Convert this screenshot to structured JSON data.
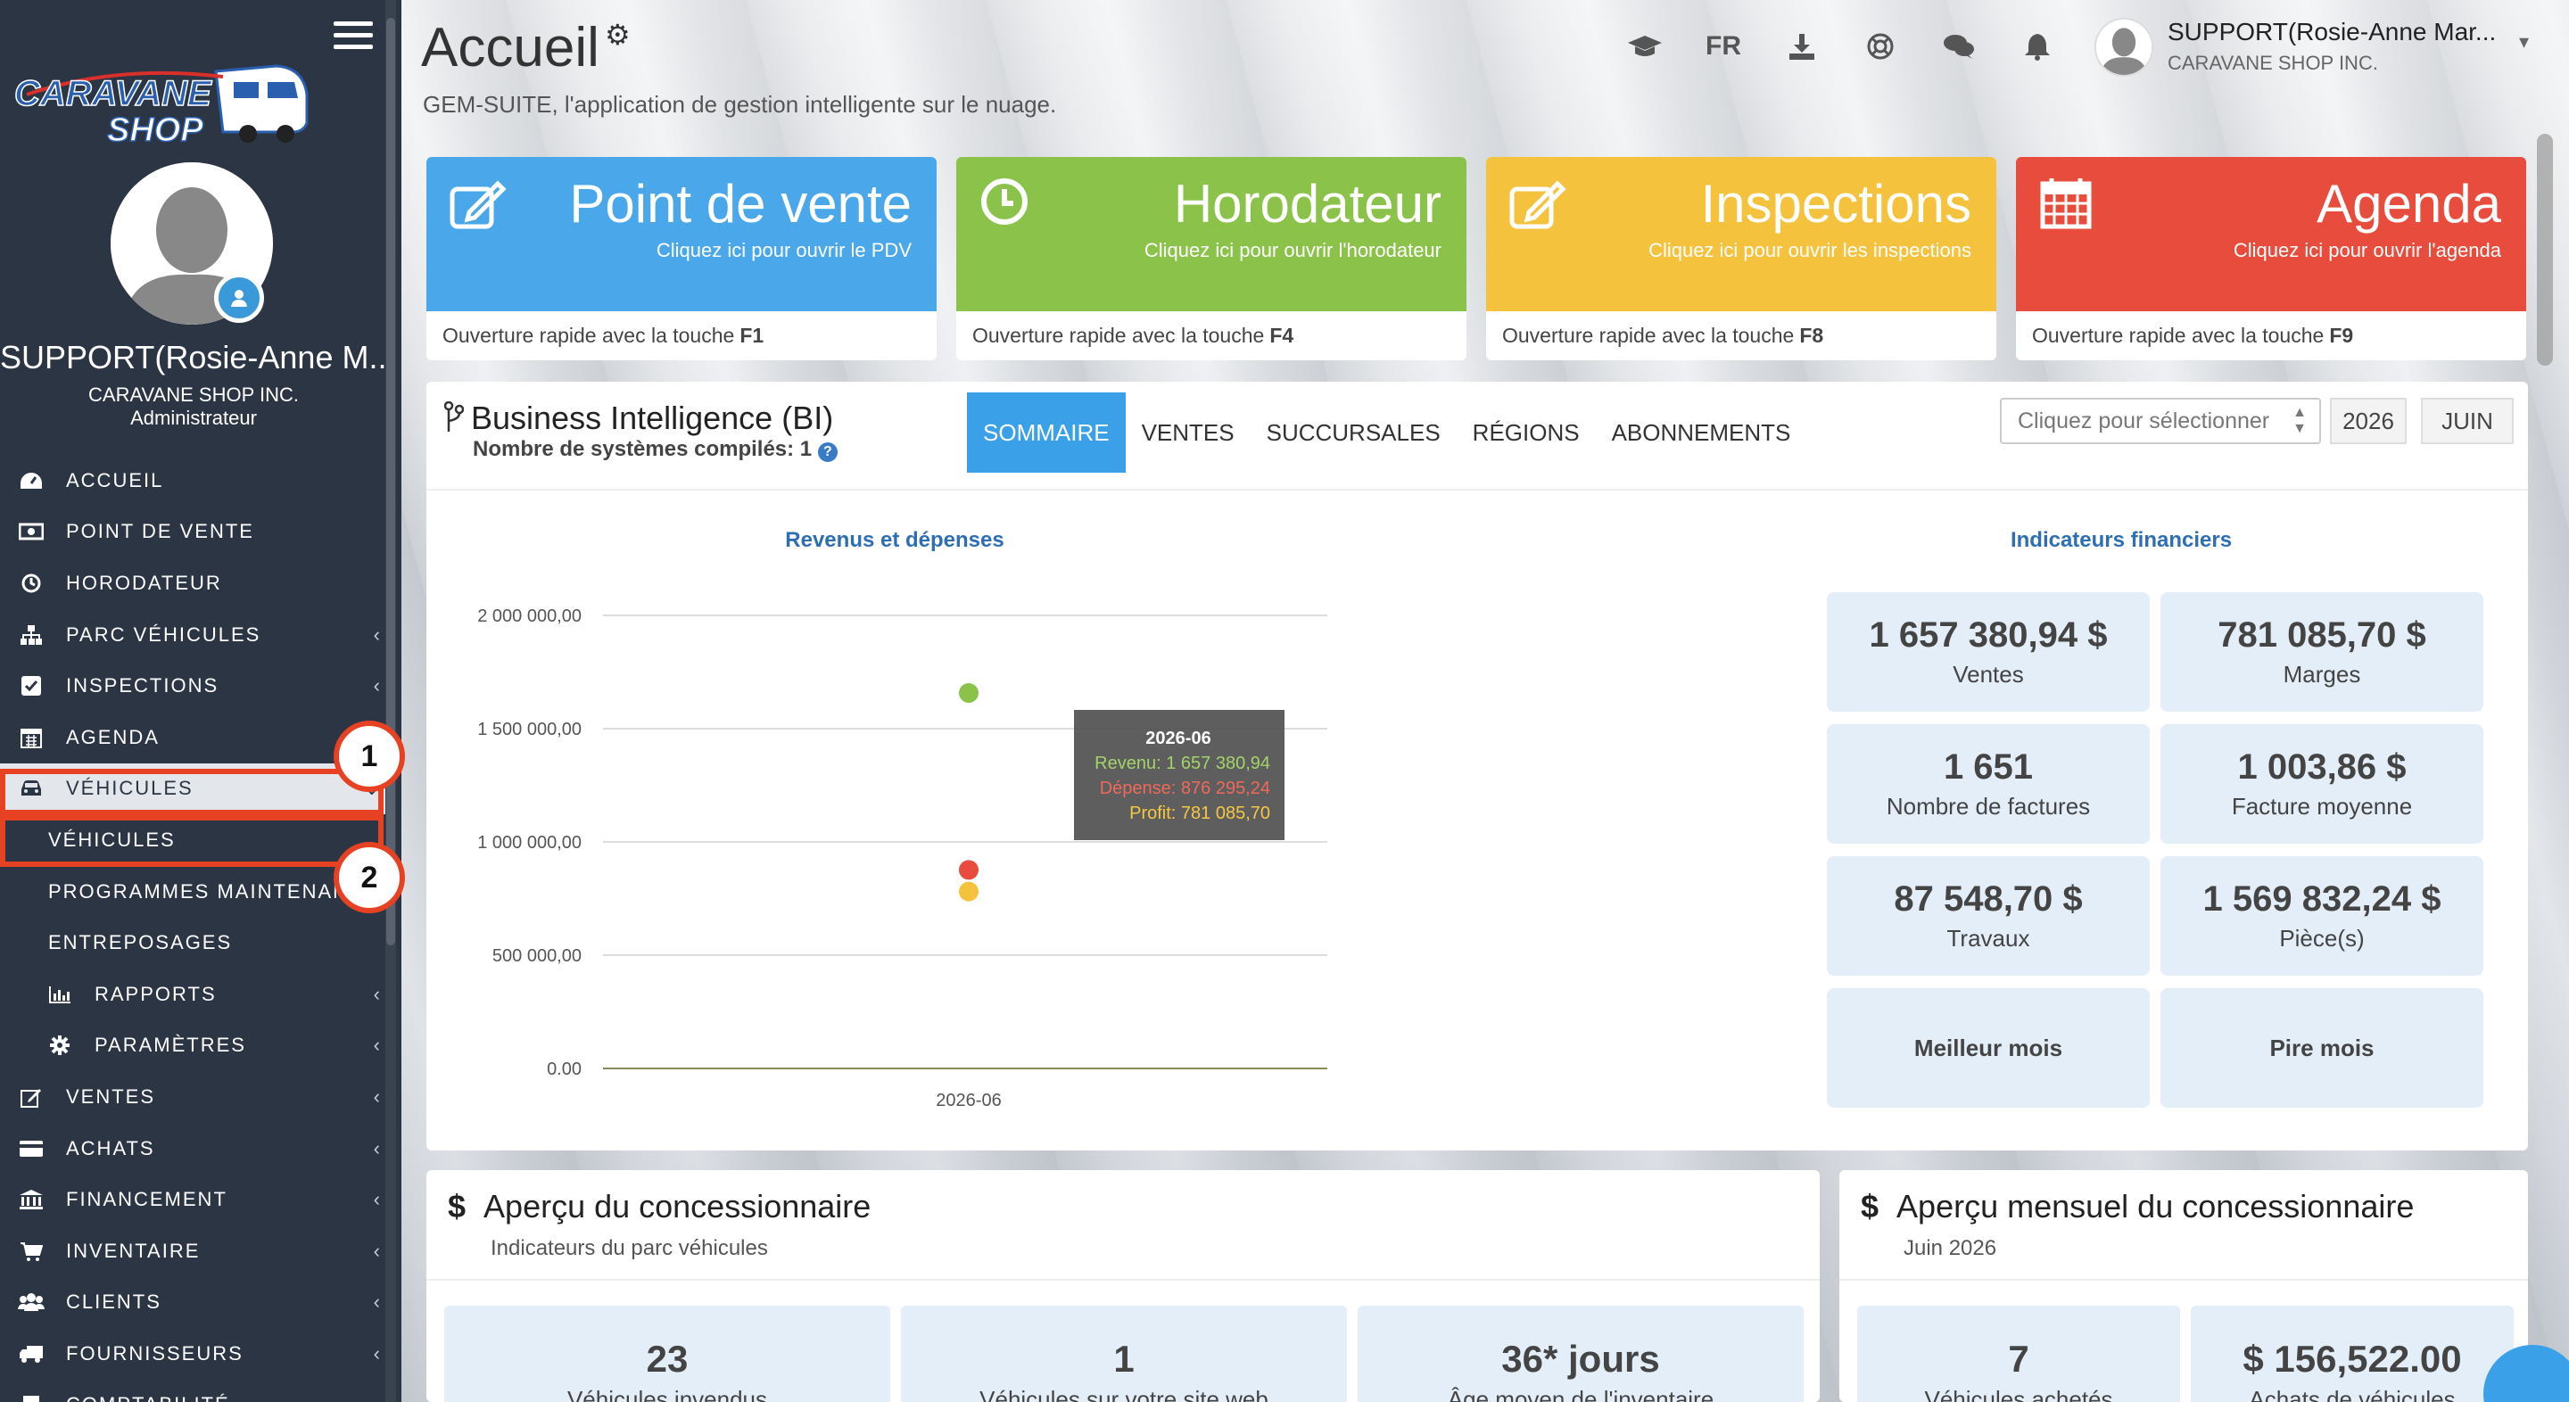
{
  "sidebar": {
    "logo_text_1": "CARAVANE",
    "logo_text_2": "SHOP",
    "user_name": "SUPPORT(Rosie-Anne M...",
    "company": "CARAVANE SHOP INC.",
    "role": "Administrateur",
    "items": [
      {
        "label": "ACCUEIL",
        "icon": "dashboard-icon",
        "chev": ""
      },
      {
        "label": "POINT DE VENTE",
        "icon": "cash-icon",
        "chev": ""
      },
      {
        "label": "HORODATEUR",
        "icon": "clock-icon",
        "chev": ""
      },
      {
        "label": "PARC VÉHICULES",
        "icon": "sitemap-icon",
        "chev": "‹"
      },
      {
        "label": "INSPECTIONS",
        "icon": "checkbox-icon",
        "chev": "‹"
      },
      {
        "label": "AGENDA",
        "icon": "calendar-icon",
        "chev": ""
      },
      {
        "label": "VÉHICULES",
        "icon": "car-icon",
        "chev": "⌄"
      },
      {
        "label": "VÉHICULES",
        "icon": "",
        "chev": ""
      },
      {
        "label": "PROGRAMMES MAINTENANC",
        "icon": "",
        "chev": ""
      },
      {
        "label": "ENTREPOSAGES",
        "icon": "",
        "chev": ""
      },
      {
        "label": "RAPPORTS",
        "icon": "bar-chart-icon",
        "chev": "‹"
      },
      {
        "label": "PARAMÈTRES",
        "icon": "gear-icon",
        "chev": "‹"
      },
      {
        "label": "VENTES",
        "icon": "edit-icon",
        "chev": "‹"
      },
      {
        "label": "ACHATS",
        "icon": "credit-card-icon",
        "chev": "‹"
      },
      {
        "label": "FINANCEMENT",
        "icon": "bank-icon",
        "chev": "‹"
      },
      {
        "label": "INVENTAIRE",
        "icon": "cart-icon",
        "chev": "‹"
      },
      {
        "label": "CLIENTS",
        "icon": "users-icon",
        "chev": "‹"
      },
      {
        "label": "FOURNISSEURS",
        "icon": "truck-icon",
        "chev": "‹"
      },
      {
        "label": "COMPTABILITÉ",
        "icon": "book-icon",
        "chev": ""
      }
    ],
    "callouts": [
      "1",
      "2"
    ]
  },
  "header": {
    "title": "Accueil",
    "subtitle": "GEM-SUITE, l'application de gestion intelligente sur le nuage.",
    "lang": "FR",
    "user_name": "SUPPORT(Rosie-Anne Mar...",
    "user_company": "CARAVANE SHOP INC."
  },
  "tiles": [
    {
      "title": "Point de vente",
      "sub": "Cliquez ici pour ouvrir le PDV",
      "foot": "Ouverture rapide avec la touche",
      "key": "F1",
      "color": "#4aa8ea",
      "icon": "edit-icon"
    },
    {
      "title": "Horodateur",
      "sub": "Cliquez ici pour ouvrir l'horodateur",
      "foot": "Ouverture rapide avec la touche",
      "key": "F4",
      "color": "#8bc34a",
      "icon": "clock-icon"
    },
    {
      "title": "Inspections",
      "sub": "Cliquez ici pour ouvrir les inspections",
      "foot": "Ouverture rapide avec la touche",
      "key": "F8",
      "color": "#f5c23e",
      "icon": "edit-icon"
    },
    {
      "title": "Agenda",
      "sub": "Cliquez ici pour ouvrir l'agenda",
      "foot": "Ouverture rapide avec la touche",
      "key": "F9",
      "color": "#e74c3c",
      "icon": "calendar-icon"
    }
  ],
  "bi": {
    "title": "Business Intelligence (BI)",
    "subtitle": "Nombre de systèmes compilés: 1",
    "tabs": [
      "SOMMAIRE",
      "VENTES",
      "SUCCURSALES",
      "RÉGIONS",
      "ABONNEMENTS"
    ],
    "select_placeholder": "Cliquez pour sélectionner",
    "year": "2026",
    "month": "JUIN",
    "chart_title": "Revenus et dépenses",
    "fin_title": "Indicateurs financiers",
    "tooltip": {
      "title": "2026-06",
      "revenu": "Revenu: 1 657 380,94",
      "depense": "Dépense: 876 295,24",
      "profit": "Profit: 781 085,70"
    },
    "indicators": [
      {
        "value": "1 657 380,94 $",
        "label": "Ventes"
      },
      {
        "value": "781 085,70 $",
        "label": "Marges"
      },
      {
        "value": "1 651",
        "label": "Nombre de factures"
      },
      {
        "value": "1 003,86 $",
        "label": "Facture moyenne"
      },
      {
        "value": "87 548,70 $",
        "label": "Travaux"
      },
      {
        "value": "1 569 832,24 $",
        "label": "Pièce(s)"
      },
      {
        "value": "",
        "label": "Meilleur mois"
      },
      {
        "value": "",
        "label": "Pire mois"
      }
    ]
  },
  "chart_data": {
    "type": "scatter",
    "title": "Revenus et dépenses",
    "categories": [
      "2026-06"
    ],
    "ylim": [
      0,
      2000000
    ],
    "y_ticks": [
      "2 000 000,00",
      "1 500 000,00",
      "1 000 000,00",
      "500 000,00",
      "0.00"
    ],
    "y_tick_values": [
      2000000,
      1500000,
      1000000,
      500000,
      0
    ],
    "series": [
      {
        "name": "Revenu",
        "values": [
          1657380.94
        ],
        "color": "#8bc34a"
      },
      {
        "name": "Dépense",
        "values": [
          876295.24
        ],
        "color": "#e74c3c"
      },
      {
        "name": "Profit",
        "values": [
          781085.7
        ],
        "color": "#f5c23e"
      }
    ],
    "grid": true
  },
  "panels": {
    "left": {
      "title": "Aperçu du concessionnaire",
      "subtitle": "Indicateurs du parc véhicules",
      "stats": [
        {
          "value": "23",
          "label": "Véhicules invendus"
        },
        {
          "value": "1",
          "label": "Véhicules sur votre site web"
        },
        {
          "value": "36* jours",
          "label": "Âge moyen de l'inventaire"
        }
      ]
    },
    "right": {
      "title": "Aperçu mensuel du concessionnaire",
      "subtitle": "Juin 2026",
      "stats": [
        {
          "value": "7",
          "label": "Véhicules achetés"
        },
        {
          "value": "$ 156,522.00",
          "label": "Achats de véhicules"
        }
      ]
    }
  }
}
